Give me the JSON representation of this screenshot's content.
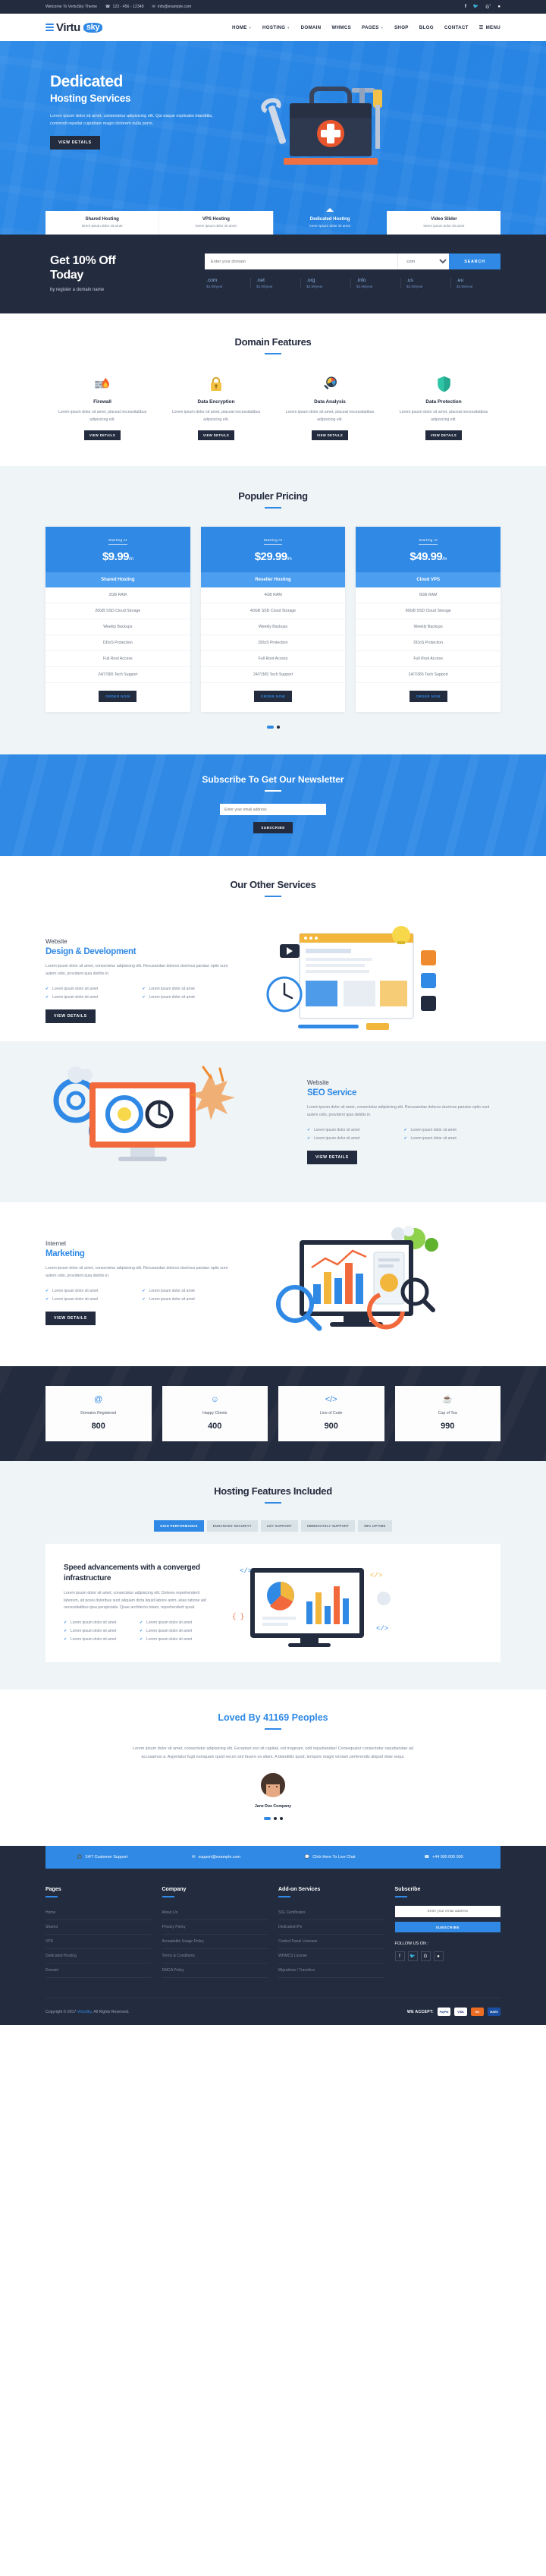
{
  "topbar": {
    "welcome": "Welcome To VertuSky Theme",
    "phone": "123 - 456 - 12348",
    "email": "info@example.com",
    "socials": [
      "facebook-icon",
      "twitter-icon",
      "google-plus-icon",
      "dribbble-icon"
    ]
  },
  "brand": {
    "name_dark": "Virtu",
    "name_accent": "sky"
  },
  "nav": {
    "items": [
      {
        "label": "HOME",
        "caret": true
      },
      {
        "label": "HOSTING",
        "caret": true
      },
      {
        "label": "DOMAIN",
        "caret": false
      },
      {
        "label": "WHMCS",
        "caret": false
      },
      {
        "label": "PAGES",
        "caret": true
      },
      {
        "label": "SHOP",
        "caret": false
      },
      {
        "label": "BLOG",
        "caret": false
      },
      {
        "label": "CONTACT",
        "caret": false
      }
    ],
    "menu_label": "MENU"
  },
  "hero": {
    "title": "Dedicated",
    "subtitle": "Hosting Services",
    "paragraph": "Lorem ipsum dolor sit amet, consectetur adipisicing elit. Qui eaque explicabo blanditiis, commodi repellat cupiditate magni dolorem nulla porro.",
    "button": "VIEW DETAILS",
    "tabs": [
      {
        "title": "Shared Hosting",
        "sub": "lorem ipsum dolor sit amet",
        "active": false
      },
      {
        "title": "VPS Hosting",
        "sub": "lorem ipsum dolor sit amet",
        "active": false
      },
      {
        "title": "Dedicated Hosting",
        "sub": "lorem ipsum dolor sit amet",
        "active": true
      },
      {
        "title": "Video Slider",
        "sub": "lorem ipsum dolor sit amet",
        "active": false
      }
    ]
  },
  "domain_search": {
    "heading_line1": "Get 10% Off",
    "heading_line2": "Today",
    "subheading": "by register a domain name",
    "placeholder": "Enter your domain",
    "selected_tld": ".com",
    "search_button": "SEARCH",
    "tlds": [
      {
        "name": ".com",
        "price": "$3.99/year"
      },
      {
        "name": ".net",
        "price": "$3.99/year"
      },
      {
        "name": ".org",
        "price": "$3.99/year"
      },
      {
        "name": ".info",
        "price": "$3.99/year"
      },
      {
        "name": ".us",
        "price": "$3.99/year"
      },
      {
        "name": ".eu",
        "price": "$3.99/year"
      }
    ]
  },
  "domain_features": {
    "title": "Domain Features",
    "items": [
      {
        "icon": "firewall-icon",
        "title": "Firewall",
        "text": "Lorem ipsum dolor sit amet, placeat necessitatibus adipisicing elit.",
        "button": "VIEW DETAILS"
      },
      {
        "icon": "lock-icon",
        "title": "Data Encryption",
        "text": "Lorem ipsum dolor sit amet, placeat necessitatibus adipisicing elit.",
        "button": "VIEW DETAILS"
      },
      {
        "icon": "magnifier-chart-icon",
        "title": "Data Analysis",
        "text": "Lorem ipsum dolor sit amet, placeat necessitatibus adipisicing elit.",
        "button": "VIEW DETAILS"
      },
      {
        "icon": "shield-icon",
        "title": "Data Protection",
        "text": "Lorem ipsum dolor sit amet, placeat necessitatibus adipisicing elit.",
        "button": "VIEW DETAILS"
      }
    ]
  },
  "pricing": {
    "title": "Populer Pricing",
    "starting_label": "Starting At",
    "per": "/m",
    "order_button": "ORDER NOW",
    "plans": [
      {
        "amount": "$9.99",
        "name": "Shared Hosting",
        "features": [
          "2GB RAM",
          "20GB SSD Cloud Storage",
          "Weekly Backups",
          "DDoS Protection",
          "Full Root Access",
          "24/7/365 Tech Support"
        ]
      },
      {
        "amount": "$29.99",
        "name": "Reseller Hosting",
        "features": [
          "4GB RAM",
          "40GB SSD Cloud Storage",
          "Weekly Backups",
          "DDoS Protection",
          "Full Root Access",
          "24/7/365 Tech Support"
        ]
      },
      {
        "amount": "$49.99",
        "name": "Cloud VPS",
        "features": [
          "8GB RAM",
          "80GB SSD Cloud Storage",
          "Weekly Backups",
          "DDoS Protection",
          "Full Root Access",
          "24/7/365 Tech Support"
        ]
      }
    ]
  },
  "newsletter": {
    "title": "Subscribe To Get Our Newsletter",
    "placeholder": "Enter your email address",
    "button": "SUBSCRIBE"
  },
  "services": {
    "title": "Our Other Services",
    "items": [
      {
        "kicker": "Website",
        "heading": "Design & Development",
        "text": "Lorem ipsum dolor sit amet, consectetur adipisicing elit. Recusandae dolores ducimus pariatur optio sunt autem odio, provident quia debitis in.",
        "bullets": [
          "Lorem ipsum dolor sit amet",
          "Lorem ipsum dolor sit amet",
          "Lorem ipsum dolor sit amet",
          "Lorem ipsum dolor sit amet"
        ],
        "button": "VIEW DETAILS"
      },
      {
        "kicker": "Website",
        "heading": "SEO Service",
        "text": "Lorem ipsum dolor sit amet, consectetur adipisicing elit. Recusandae dolores ducimus pariatur optio sunt autem odio, provident quia debitis in.",
        "bullets": [
          "Lorem ipsum dolor sit amet",
          "Lorem ipsum dolor sit amet",
          "Lorem ipsum dolor sit amet",
          "Lorem ipsum dolor sit amet"
        ],
        "button": "VIEW DETAILS"
      },
      {
        "kicker": "Internet",
        "heading": "Marketing",
        "text": "Lorem ipsum dolor sit amet, consectetur adipisicing elit. Recusandae dolores ducimus pariatur optio sunt autem odio, provident quia debitis in.",
        "bullets": [
          "Lorem ipsum dolor sit amet",
          "Lorem ipsum dolor sit amet",
          "Lorem ipsum dolor sit amet",
          "Lorem ipsum dolor sit amet"
        ],
        "button": "VIEW DETAILS"
      }
    ]
  },
  "counters": [
    {
      "icon": "at-icon",
      "label": "Domains Registered",
      "value": "800"
    },
    {
      "icon": "smiley-icon",
      "label": "Happy Clients",
      "value": "400"
    },
    {
      "icon": "code-icon",
      "label": "Line of Code",
      "value": "900"
    },
    {
      "icon": "tea-cup-icon",
      "label": "Cup of Tea",
      "value": "990"
    }
  ],
  "hosting_features": {
    "title": "Hosting Features Included",
    "tabs": [
      {
        "label": "HIGH PERFORMANCE",
        "active": true
      },
      {
        "label": "ENHANCED SECURITY",
        "active": false
      },
      {
        "label": "24/7 SUPPORT",
        "active": false
      },
      {
        "label": "IMMEDIATELY SUPPORT",
        "active": false
      },
      {
        "label": "99% UPTIME",
        "active": false
      }
    ],
    "panel": {
      "heading": "Speed advancements with a converged infrastructure",
      "text": "Lorem ipsum dolor sit amet, consectetur adipisicing elit. Dolores reprehenderit laborum, alt possi doloribus sunt aliquam dicta liquid labore anim, elias ratione aid necessitatibus ipsa perspiciatis. Quae architecto totam, reprehenderit quod.",
      "bullets": [
        "Lorem ipsum dolor sit amet",
        "Lorem ipsum dolor sit amet",
        "Lorem ipsum dolor sit amet",
        "Lorem ipsum dolor sit amet",
        "Lorem ipsum dolor sit amet",
        "Lorem ipsum dolor sit amet"
      ]
    }
  },
  "testimonial": {
    "heading_pre": "Loved By ",
    "heading_count": "41169",
    "heading_post": " Peoples",
    "quote": "Lorem ipsum dolor sit amet, consectetur adipisicing elit. Excepturi eos sit capitali, est magnam, odit repudiandae! Consequatur consectetur repudiandae ad accusamus a. Asperiatur fugit numquam quod rerum sint facere ex aliam. A blanditiis quod, tempore magni veniam perferendis aliquid vitae sequi.",
    "name": "Jane Doe Company",
    "role": "Company"
  },
  "footer": {
    "contact": [
      {
        "icon": "headset-icon",
        "label": "24/7 Customer Support"
      },
      {
        "icon": "envelope-icon",
        "label": "support@example.com"
      },
      {
        "icon": "chat-icon",
        "label": "Click Here To Live Chat"
      },
      {
        "icon": "phone-icon",
        "label": "+44 000 000 000"
      }
    ],
    "columns": [
      {
        "title": "Pages",
        "links": [
          "Home",
          "Shared",
          "VPS",
          "Dedicated Hosting",
          "Domain"
        ]
      },
      {
        "title": "Company",
        "links": [
          "About Us",
          "Privacy Policy",
          "Acceptable Usage Policy",
          "Terms & Conditions",
          "DMCA Policy"
        ]
      },
      {
        "title": "Add-on Services",
        "links": [
          "SSL Certificates",
          "Dedicated IPs",
          "Control Panel Licenses",
          "WHMCS License",
          "Migrations / Transfers"
        ]
      }
    ],
    "subscribe": {
      "title": "Subscribe",
      "placeholder": "Enter your email address",
      "button": "SUBSCRIBE",
      "follow_label": "FOLLOW US ON :",
      "socials": [
        "facebook-icon",
        "twitter-icon",
        "google-plus-icon",
        "dribbble-icon"
      ]
    },
    "copyright_pre": "Copyright © 2017 ",
    "copyright_brand": "VirtuSky",
    "copyright_post": ". All Rights Reserved.",
    "accept_label": "WE ACCEPT:",
    "cards": [
      {
        "name": "PayPal",
        "bg": "#ffffff",
        "fg": "#1b3d80"
      },
      {
        "name": "VISA",
        "bg": "#ffffff",
        "fg": "#1a1f71"
      },
      {
        "name": "MC",
        "bg": "#eb6c23",
        "fg": "#ffffff"
      },
      {
        "name": "MAES",
        "bg": "#1a4ea2",
        "fg": "#ffffff"
      }
    ]
  },
  "colors": {
    "accent": "#2f89e5",
    "dark": "#232b3e",
    "light": "#eff4f6"
  }
}
